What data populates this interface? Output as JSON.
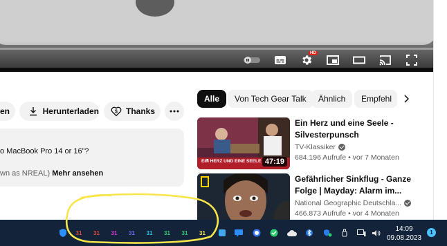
{
  "actions": {
    "share_partial": "en",
    "download_label": "Herunterladen",
    "thanks_label": "Thanks"
  },
  "description": {
    "line1": "o MacBook Pro 14 or 16”?",
    "line2_prefix": "wn as NREAL)",
    "more_label": "Mehr ansehen"
  },
  "chips": [
    "Alle",
    "Von Tech Gear Talk",
    "Ähnlich",
    "Empfehl"
  ],
  "recommendations": [
    {
      "title": "Ein Herz und eine Seele - Silvesterpunsch",
      "channel": "TV-Klassiker",
      "meta": "684.196 Aufrufe  • vor 7 Monaten",
      "duration": "47:19",
      "thumb_caption": "EIN HERZ UND EINE SEELE"
    },
    {
      "title": "Gefährlicher Sinkflug - Ganze Folge | Mayday: Alarm im...",
      "channel": "National Geographic Deutschla...",
      "meta": "466.873 Aufrufe  • vor 4 Monaten"
    }
  ],
  "video": {
    "hd_badge": "HD"
  },
  "taskbar": {
    "calendar_days": [
      "31",
      "31",
      "31",
      "31",
      "31",
      "31",
      "31",
      "31"
    ],
    "calendar_colors": [
      "#e04a3a",
      "#e04a3a",
      "#d63bd6",
      "#6e6ef0",
      "#22c4e6",
      "#2ecc71",
      "#2ecc71",
      "#f5e050"
    ],
    "time": "14:09",
    "date": "09.08.2023",
    "notification_count": "1"
  }
}
